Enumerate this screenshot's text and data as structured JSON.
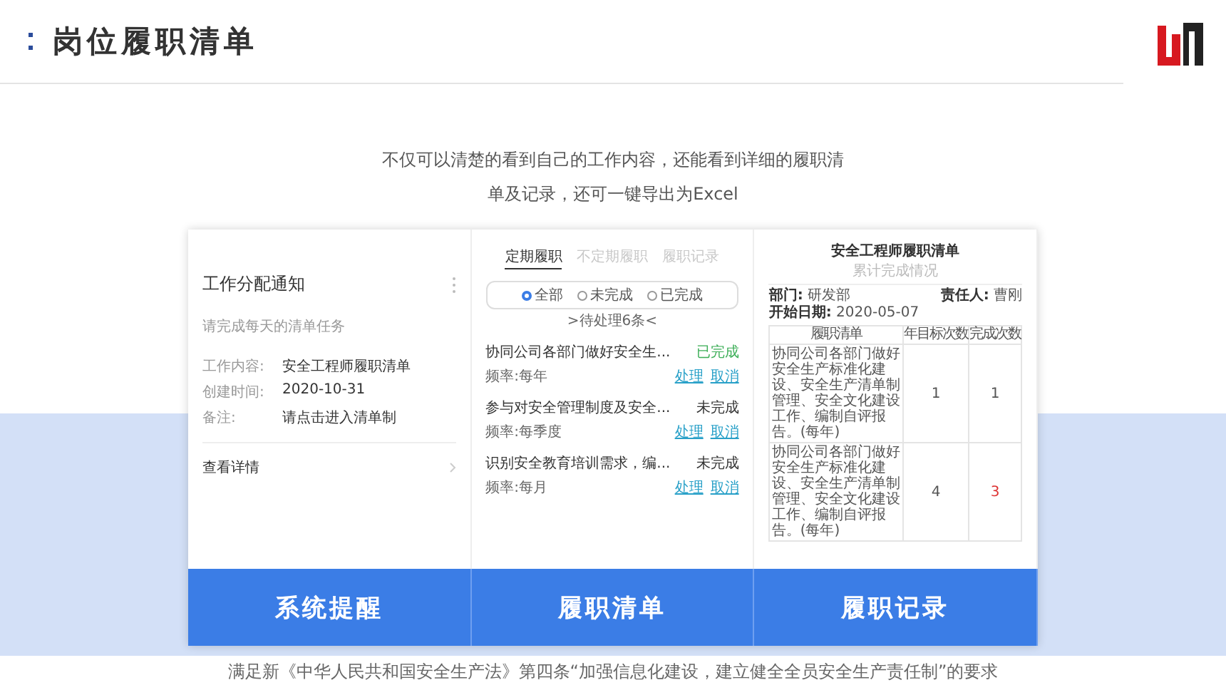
{
  "header": {
    "title": "岗位履职清单"
  },
  "intro_lines": [
    "不仅可以清楚的看到自己的工作内容，还能看到详细的履职清",
    "单及记录，还可一键导出为Excel"
  ],
  "notice": {
    "title": "工作分配通知",
    "subtitle": "请完成每天的清单任务",
    "fields": [
      {
        "label": "工作内容:",
        "value": "安全工程师履职清单"
      },
      {
        "label": "创建时间:",
        "value": "2020-10-31"
      },
      {
        "label": "备注:",
        "value": "请点击进入清单制"
      }
    ],
    "details": "查看详情"
  },
  "checklist": {
    "tabs": [
      {
        "label": "定期履职",
        "selected": true
      },
      {
        "label": "不定期履职",
        "selected": false
      },
      {
        "label": "履职记录",
        "selected": false
      }
    ],
    "filters": [
      {
        "label": "全部",
        "selected": true
      },
      {
        "label": "未完成",
        "selected": false
      },
      {
        "label": "已完成",
        "selected": false
      }
    ],
    "pending": ">待处理6条<",
    "items": [
      {
        "title": "协同公司各部门做好安全生...",
        "frequency": "频率:每年",
        "status": "已完成",
        "kind": "done",
        "actions": [
          "处理",
          "取消"
        ]
      },
      {
        "title": "参与对安全管理制度及安全...",
        "frequency": "频率:每季度",
        "status": "未完成",
        "kind": "pending",
        "actions": [
          "处理",
          "取消"
        ]
      },
      {
        "title": "识别安全教育培训需求，编...",
        "frequency": "频率:每月",
        "status": "未完成",
        "kind": "pending",
        "actions": [
          "处理",
          "取消"
        ]
      }
    ]
  },
  "record": {
    "title": "安全工程师履职清单",
    "subtitle": "累计完成情况",
    "department_label": "部门:",
    "department": "研发部",
    "owner_label": "责任人:",
    "owner": "曹刚",
    "start_label": "开始日期:",
    "start": "2020-05-07",
    "columns": [
      "履职清单",
      "年目标次数",
      "完成次数"
    ],
    "rows": [
      {
        "duty": "协同公司各部门做好安全生产标准化建设、安全生产清单制管理、安全文化建设工作、编制自评报告。(每年)",
        "target": "1",
        "done": "1",
        "behind": false
      },
      {
        "duty": "协同公司各部门做好安全生产标准化建设、安全生产清单制管理、安全文化建设工作、编制自评报告。(每年)",
        "target": "4",
        "done": "3",
        "behind": true
      }
    ]
  },
  "features": [
    "系统提醒",
    "履职清单",
    "履职记录"
  ],
  "footer": "满足新《中华人民共和国安全生产法》第四条“加强信息化建设，建立健全全员安全生产责任制”的要求"
}
